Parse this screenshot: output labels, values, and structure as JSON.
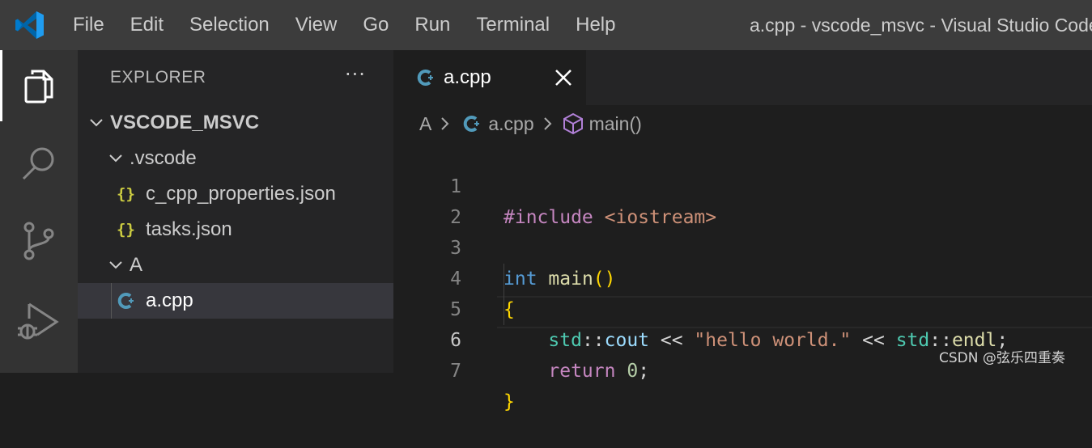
{
  "titlebar": {
    "menu": [
      "File",
      "Edit",
      "Selection",
      "View",
      "Go",
      "Run",
      "Terminal",
      "Help"
    ],
    "window_title": "a.cpp - vscode_msvc - Visual Studio Code"
  },
  "activity_bar": {
    "icons": [
      "files-icon",
      "search-icon",
      "source-control-icon",
      "run-debug-icon"
    ]
  },
  "sidebar": {
    "header": "EXPLORER",
    "more": "···",
    "tree": [
      {
        "label": "VSCODE_MSVC",
        "type": "folder-root"
      },
      {
        "label": ".vscode",
        "type": "folder"
      },
      {
        "label": "c_cpp_properties.json",
        "type": "json"
      },
      {
        "label": "tasks.json",
        "type": "json"
      },
      {
        "label": "A",
        "type": "folder"
      },
      {
        "label": "a.cpp",
        "type": "cpp"
      }
    ],
    "json_glyph": "{}"
  },
  "editor": {
    "tab_label": "a.cpp",
    "breadcrumb": {
      "folder": "A",
      "file": "a.cpp",
      "symbol": "main()"
    },
    "line_numbers": [
      "1",
      "2",
      "3",
      "4",
      "5",
      "6",
      "7"
    ],
    "current_line": "6",
    "tokens": {
      "l1_pre": "#include",
      "l1_hdr": "<iostream>",
      "l3_kw": "int",
      "l3_fn": "main",
      "l3_par": "()",
      "l4": "{",
      "l5_ns1": "std",
      "l5_sep1": "::",
      "l5_cout": "cout",
      "l5_op1": " << ",
      "l5_str": "\"hello world.\"",
      "l5_op2": " << ",
      "l5_ns2": "std",
      "l5_sep2": "::",
      "l5_endl": "endl",
      "l5_semi": ";",
      "l6_ret": "return",
      "l6_num": "0",
      "l6_semi": ";",
      "l7": "}"
    }
  },
  "watermark": "CSDN @弦乐四重奏",
  "colors": {
    "accent": "#0078d4",
    "cpp_icon": "#519aba",
    "json_icon": "#cbcb41",
    "symbol_icon": "#b180d7"
  }
}
